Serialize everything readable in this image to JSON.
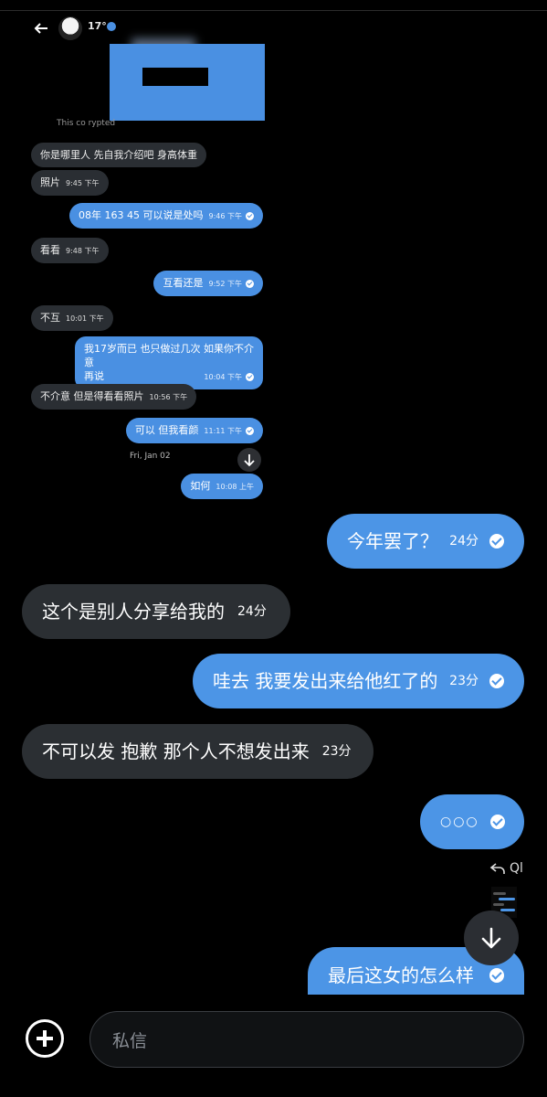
{
  "screenshot": {
    "header": {
      "name": "17°"
    },
    "notice": "This co                              rypted",
    "messages": [
      {
        "dir": "in",
        "text": "你是哪里人 先自我介绍吧 身高体重",
        "time": ""
      },
      {
        "dir": "in",
        "text": "照片",
        "time": "9:45 下午"
      },
      {
        "dir": "out",
        "text": "08年 163 45 可以说是处吗",
        "time": "9:46 下午"
      },
      {
        "dir": "in",
        "text": "看看",
        "time": "9:48 下午"
      },
      {
        "dir": "out",
        "text": "互看还是",
        "time": "9:52 下午"
      },
      {
        "dir": "in",
        "text": "不互",
        "time": "10:01 下午"
      },
      {
        "dir": "out",
        "text_line1": "我17岁而已 也只做过几次 如果你不介意",
        "text_line2": "再说",
        "time": "10:04 下午"
      },
      {
        "dir": "in",
        "text": "不介意 但是得看看照片",
        "time": "10:56 下午"
      },
      {
        "dir": "out",
        "text": "可以 但我看颜",
        "time": "11:11 下午"
      },
      {
        "dir": "out",
        "text": "如何",
        "time": "10:08 上午"
      }
    ],
    "date_divider": "Fri, Jan 02"
  },
  "chat": {
    "messages": [
      {
        "dir": "out",
        "text": "今年罢了？",
        "time": "24分"
      },
      {
        "dir": "in",
        "text": "这个是别人分享给我的",
        "time": "24分"
      },
      {
        "dir": "out",
        "text": "哇去 我要发出来给他红了的",
        "time": "23分"
      },
      {
        "dir": "in",
        "text": "不可以发 抱歉 那个人不想发出来",
        "time": "23分"
      },
      {
        "dir": "out",
        "text": "○○○",
        "time": ""
      },
      {
        "dir": "out",
        "text": "最后这女的怎么样",
        "time": ""
      }
    ],
    "reply_label": "Ql"
  },
  "composer": {
    "placeholder": "私信"
  },
  "colors": {
    "accent": "#4c95e6",
    "incoming": "#2b2f33",
    "background": "#000000"
  }
}
